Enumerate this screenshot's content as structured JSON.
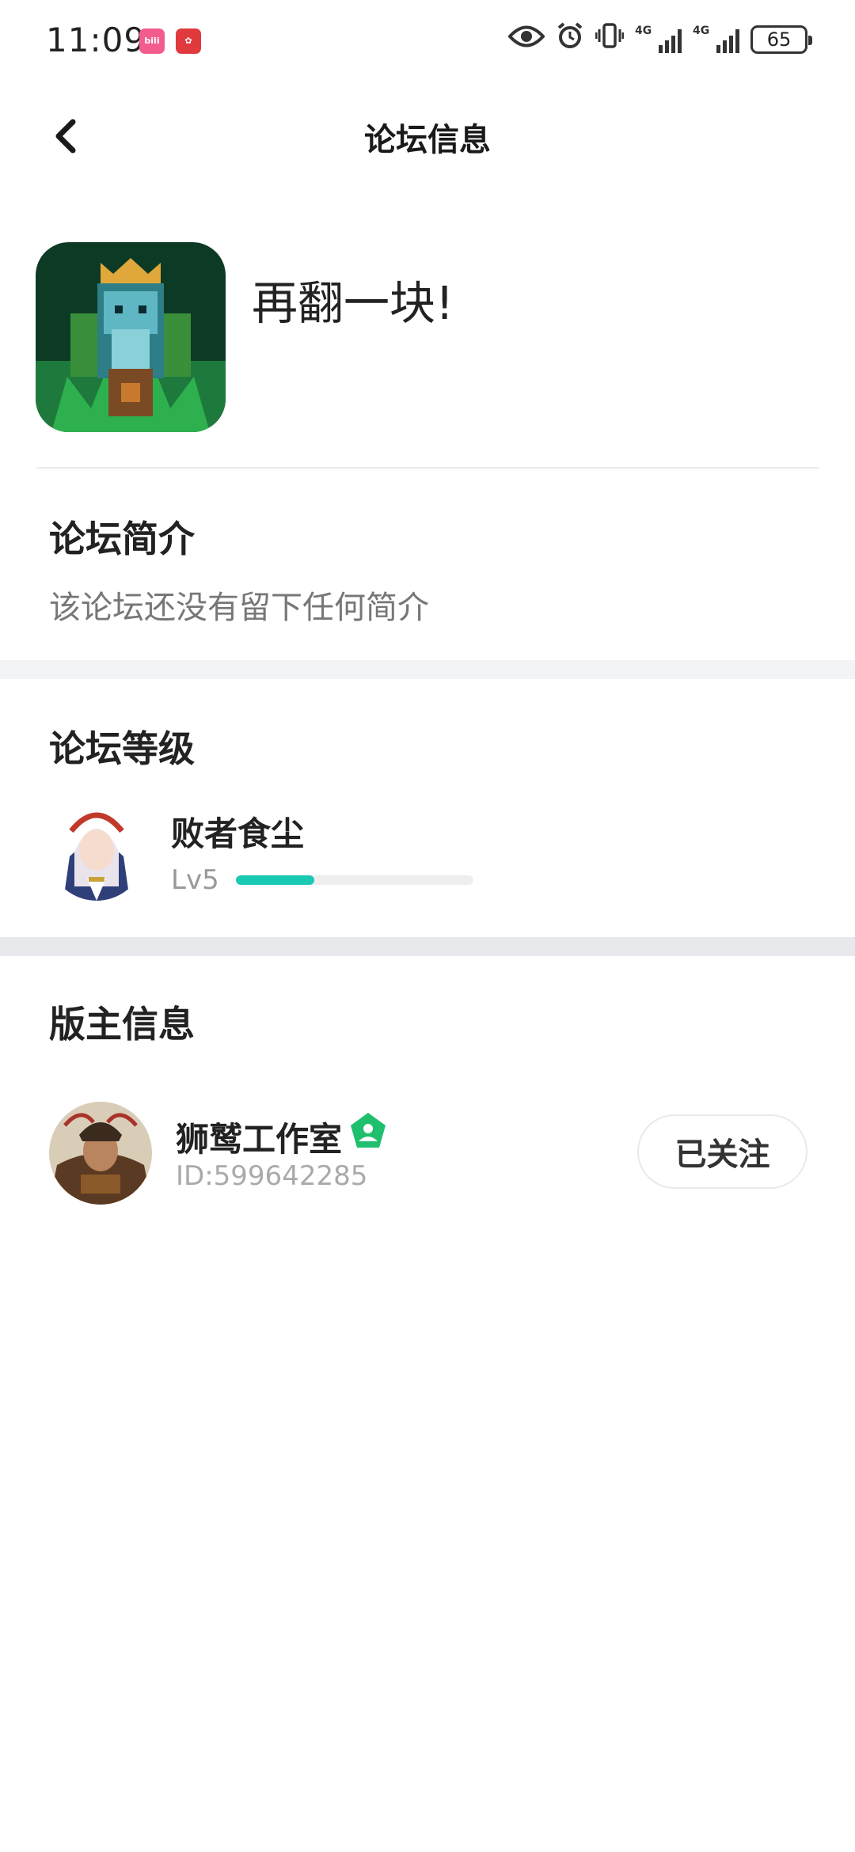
{
  "status_bar": {
    "time": "11:09",
    "app_badges": [
      "bilibili",
      "huawei"
    ],
    "icons": [
      "eye-icon",
      "alarm-icon",
      "vibrate-icon",
      "signal-4g-icon",
      "signal-4g-icon"
    ],
    "network_1": "4G",
    "network_2": "4G",
    "battery": "65"
  },
  "header": {
    "title": "论坛信息",
    "back_icon": "chevron-left-icon"
  },
  "forum": {
    "name": "再翻一块!",
    "icon": "forum-game-icon"
  },
  "intro": {
    "title": "论坛简介",
    "text": "该论坛还没有留下任何简介"
  },
  "level": {
    "title": "论坛等级",
    "user_name": "败者食尘",
    "level_label": "Lv5",
    "progress": 0.33,
    "progress_color": "#19c9b4"
  },
  "moderator": {
    "title": "版主信息",
    "name": "狮鹫工作室",
    "id_text": "ID:599642285",
    "badge_color": "#1fbf6e",
    "follow_label": "已关注"
  }
}
